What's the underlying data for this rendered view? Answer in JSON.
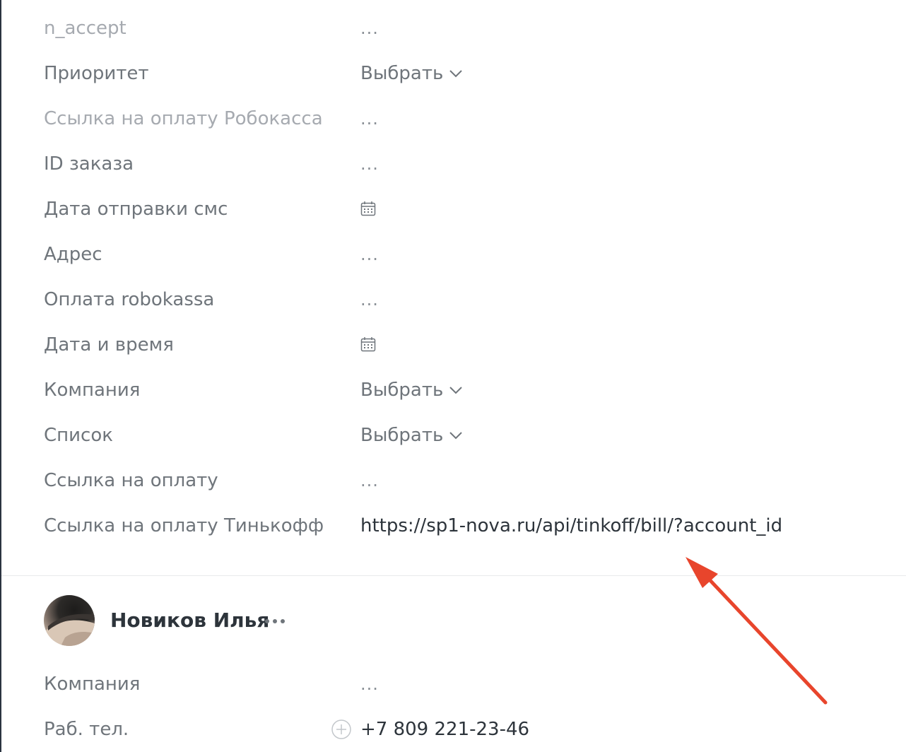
{
  "fields": [
    {
      "label": "n_accept",
      "value": "...",
      "type": "text",
      "muted": true
    },
    {
      "label": "Приоритет",
      "value": "Выбрать",
      "type": "select"
    },
    {
      "label": "Ссылка на оплату Робокасса",
      "value": "...",
      "type": "text",
      "muted": true
    },
    {
      "label": "ID заказа",
      "value": "...",
      "type": "text"
    },
    {
      "label": "Дата отправки смс",
      "value": "",
      "type": "date",
      "icon": "calendar-icon"
    },
    {
      "label": "Адрес",
      "value": "...",
      "type": "text"
    },
    {
      "label": "Оплата robokassa",
      "value": "...",
      "type": "text"
    },
    {
      "label": "Дата и время",
      "value": "",
      "type": "date",
      "icon": "calendar-icon"
    },
    {
      "label": "Компания",
      "value": "Выбрать",
      "type": "select"
    },
    {
      "label": "Список",
      "value": "Выбрать",
      "type": "select"
    },
    {
      "label": "Ссылка на оплату",
      "value": "...",
      "type": "text"
    },
    {
      "label": "Ссылка на оплату Тинькофф",
      "value": "https://sp1-nova.ru/api/tinkoff/bill/?account_id",
      "type": "url"
    }
  ],
  "contact": {
    "name": "Новиков Илья",
    "more_icon": "more-dots-icon",
    "fields": [
      {
        "label": "Компания",
        "value": "..."
      },
      {
        "label": "Раб. тел.",
        "value": "+7 809 221-23-46",
        "icon": "plus-circle-icon"
      }
    ]
  },
  "annotation": {
    "color": "#e8452c",
    "icon": "red-arrow-annotation"
  }
}
